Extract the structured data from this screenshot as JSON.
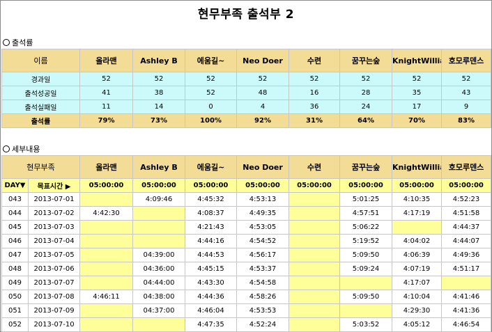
{
  "title": "현무부족 출석부 2",
  "section1": "출석률",
  "section2": "세부내용",
  "summary": {
    "header_label": "이름",
    "names": [
      "올라맨",
      "Ashley B",
      "에움길~",
      "Neo Doer",
      "수련",
      "꿈꾸는숲",
      "KnightWillia",
      "호모루덴스"
    ],
    "rows": [
      {
        "label": "경과일",
        "values": [
          "52",
          "52",
          "52",
          "52",
          "52",
          "52",
          "52",
          "52"
        ]
      },
      {
        "label": "출석성공일",
        "values": [
          "41",
          "38",
          "52",
          "48",
          "16",
          "28",
          "35",
          "43"
        ]
      },
      {
        "label": "출석실패일",
        "values": [
          "11",
          "14",
          "0",
          "4",
          "36",
          "24",
          "17",
          "9"
        ]
      },
      {
        "label": "출석률",
        "values": [
          "79%",
          "73%",
          "100%",
          "92%",
          "31%",
          "64%",
          "70%",
          "83%"
        ]
      }
    ]
  },
  "detail": {
    "header_label": "현무부족",
    "names": [
      "올라맨",
      "Ashley B",
      "에움길~",
      "Neo Doer",
      "수련",
      "꿈꾸는숲",
      "KnightWillia",
      "호모루덴스"
    ],
    "day_label": "DAY▼",
    "goal_label": "목표시간 ▶",
    "goal_times": [
      "05:00:00",
      "05:00:00",
      "05:00:00",
      "05:00:00",
      "05:00:00",
      "05:00:00",
      "05:00:00",
      "05:00:00"
    ],
    "rows": [
      {
        "day": "043",
        "date": "2013-07-01",
        "values": [
          "",
          "4:09:46",
          "4:45:32",
          "4:53:13",
          "",
          "5:01:25",
          "4:10:35",
          "4:52:23"
        ]
      },
      {
        "day": "044",
        "date": "2013-07-02",
        "values": [
          "4:42:30",
          "",
          "4:08:37",
          "4:49:35",
          "",
          "4:57:51",
          "4:17:19",
          "4:51:58"
        ]
      },
      {
        "day": "045",
        "date": "2013-07-03",
        "values": [
          "",
          "",
          "4:21:43",
          "4:53:05",
          "",
          "5:06:22",
          "",
          "4:44:37"
        ]
      },
      {
        "day": "046",
        "date": "2013-07-04",
        "values": [
          "",
          "",
          "4:44:16",
          "4:54:52",
          "",
          "5:19:52",
          "4:04:02",
          "4:44:07"
        ]
      },
      {
        "day": "047",
        "date": "2013-07-05",
        "values": [
          "",
          "04:39:00",
          "4:44:53",
          "4:56:17",
          "",
          "5:09:50",
          "4:06:39",
          "4:49:36"
        ]
      },
      {
        "day": "048",
        "date": "2013-07-06",
        "values": [
          "",
          "04:36:00",
          "4:45:15",
          "4:53:37",
          "",
          "5:09:24",
          "4:07:19",
          "4:51:17"
        ]
      },
      {
        "day": "049",
        "date": "2013-07-07",
        "values": [
          "",
          "04:44:00",
          "4:43:30",
          "4:54:58",
          "",
          "",
          "4:17:07",
          ""
        ]
      },
      {
        "day": "050",
        "date": "2013-07-08",
        "values": [
          "4:46:11",
          "04:38:00",
          "4:44:36",
          "4:58:26",
          "",
          "5:09:50",
          "4:10:04",
          "4:41:46"
        ]
      },
      {
        "day": "051",
        "date": "2013-07-09",
        "values": [
          "",
          "04:37:00",
          "4:46:04",
          "4:53:53",
          "",
          "",
          "4:29:30",
          "4:41:36"
        ]
      },
      {
        "day": "052",
        "date": "2013-07-10",
        "values": [
          "",
          "",
          "4:47:35",
          "4:52:24",
          "",
          "5:03:52",
          "4:05:12",
          "4:46:54"
        ]
      }
    ],
    "highlight": [
      [
        1,
        0,
        0,
        0,
        1,
        0,
        0,
        0
      ],
      [
        0,
        1,
        0,
        0,
        1,
        0,
        0,
        0
      ],
      [
        1,
        1,
        0,
        0,
        1,
        0,
        1,
        0
      ],
      [
        1,
        1,
        0,
        0,
        1,
        0,
        0,
        0
      ],
      [
        1,
        0,
        0,
        0,
        1,
        0,
        0,
        0
      ],
      [
        1,
        0,
        0,
        0,
        1,
        0,
        0,
        0
      ],
      [
        1,
        0,
        0,
        0,
        1,
        1,
        0,
        1
      ],
      [
        0,
        0,
        0,
        0,
        1,
        0,
        0,
        0
      ],
      [
        1,
        0,
        0,
        0,
        1,
        1,
        0,
        0
      ],
      [
        1,
        1,
        0,
        0,
        1,
        0,
        0,
        0
      ]
    ]
  },
  "colors": {
    "header": "#f3dc96",
    "cyan": "#ccfafa",
    "yellow": "#ffff99"
  }
}
